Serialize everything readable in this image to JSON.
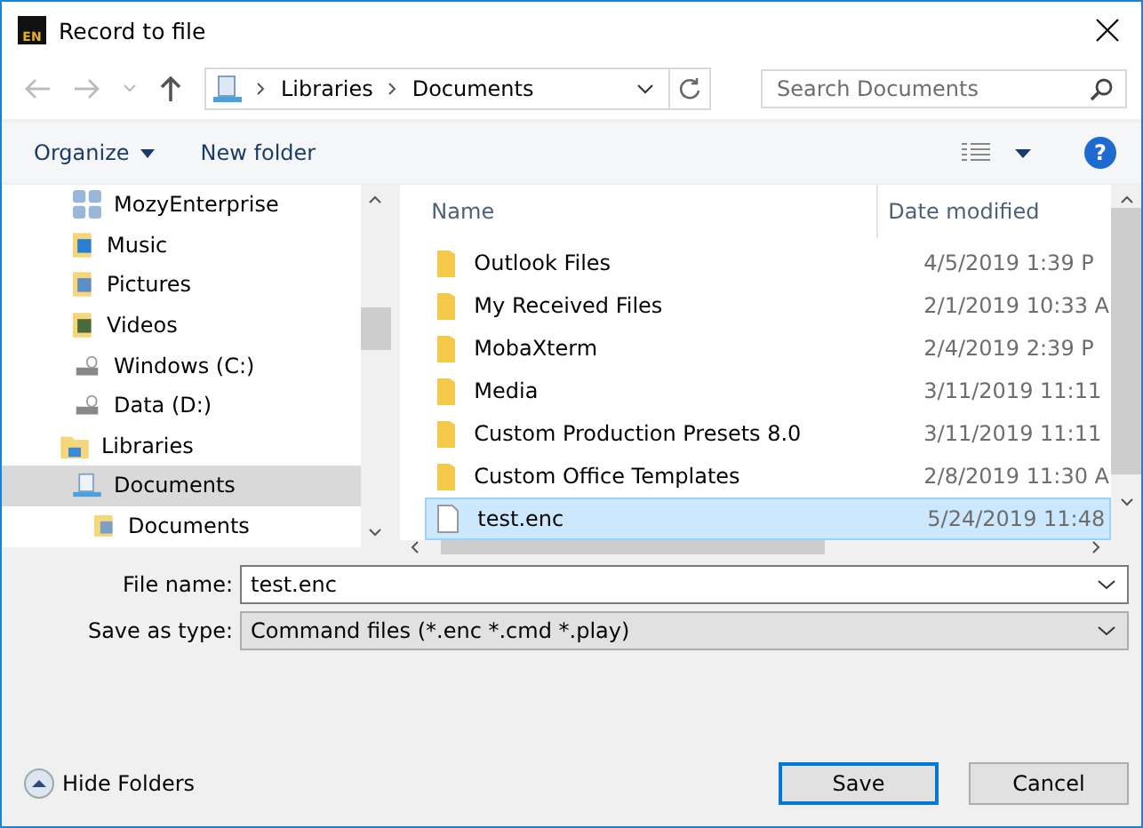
{
  "window": {
    "title": "Record to file",
    "app_icon_text": "EN"
  },
  "address_bar": {
    "crumbs": [
      "Libraries",
      "Documents"
    ]
  },
  "search": {
    "placeholder": "Search Documents"
  },
  "toolbar": {
    "organize": "Organize",
    "new_folder": "New folder",
    "help": "?"
  },
  "nav": {
    "upper_items": [
      {
        "label": "MozyEnterprise",
        "kind": "app"
      },
      {
        "label": "Music",
        "kind": "music"
      },
      {
        "label": "Pictures",
        "kind": "pictures"
      },
      {
        "label": "Videos",
        "kind": "videos"
      },
      {
        "label": "Windows (C:)",
        "kind": "drive"
      },
      {
        "label": "Data (D:)",
        "kind": "drive"
      }
    ],
    "tree": [
      {
        "label": "Libraries",
        "selected": false,
        "children": [
          {
            "label": "Documents",
            "selected": true,
            "children": [
              {
                "label": "Documents",
                "selected": false
              }
            ]
          }
        ]
      }
    ]
  },
  "table": {
    "columns": [
      "Name",
      "Date modified"
    ],
    "rows": [
      {
        "name": "Outlook Files",
        "date": "4/5/2019 1:39 P",
        "kind": "folder",
        "selected": false
      },
      {
        "name": "My Received Files",
        "date": "2/1/2019 10:33 A",
        "kind": "folder",
        "selected": false
      },
      {
        "name": "MobaXterm",
        "date": "2/4/2019 2:39 P",
        "kind": "folder",
        "selected": false
      },
      {
        "name": "Media",
        "date": "3/11/2019 11:11",
        "kind": "folder",
        "selected": false
      },
      {
        "name": "Custom Production Presets 8.0",
        "date": "3/11/2019 11:11",
        "kind": "folder",
        "selected": false
      },
      {
        "name": "Custom Office Templates",
        "date": "2/8/2019 11:30 A",
        "kind": "folder",
        "selected": false
      },
      {
        "name": "test.enc",
        "date": "5/24/2019 11:48",
        "kind": "file",
        "selected": true
      }
    ]
  },
  "form": {
    "file_name_label": "File name:",
    "file_name": "test.enc",
    "type_label": "Save as type:",
    "type_value": "Command files (*.enc *.cmd *.play)"
  },
  "footer": {
    "hide_folders": "Hide Folders",
    "save": "Save",
    "cancel": "Cancel"
  }
}
